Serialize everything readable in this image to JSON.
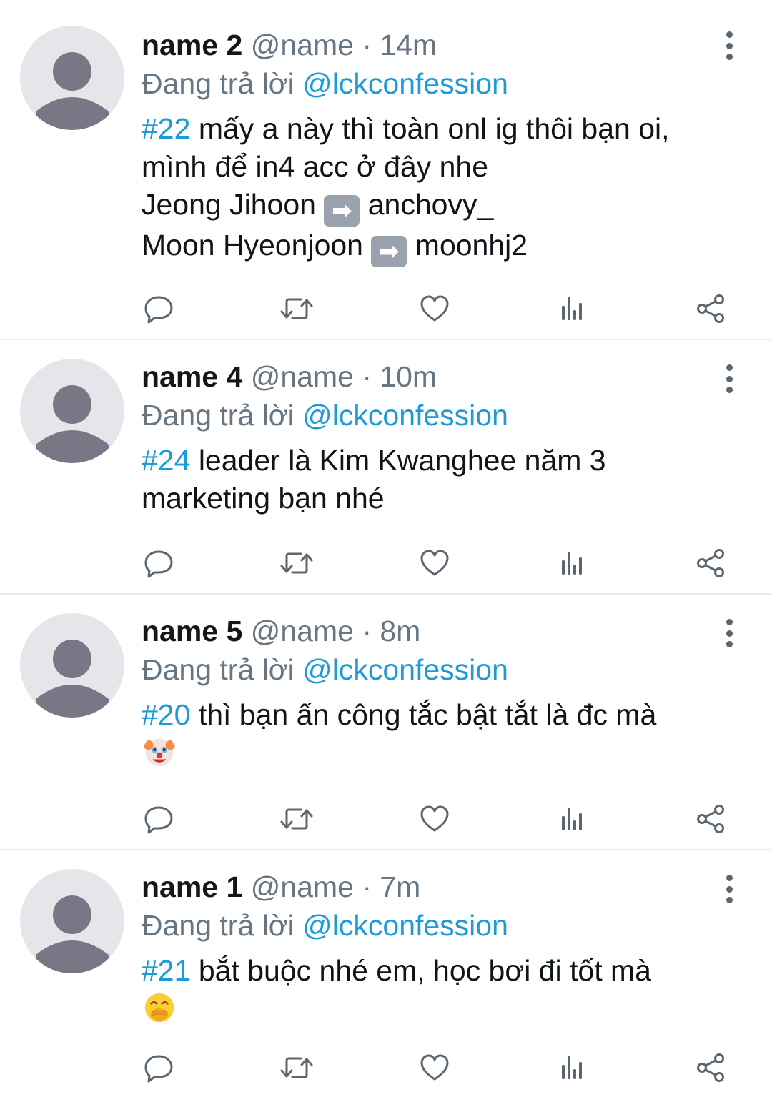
{
  "colors": {
    "accent": "#1d9bd8",
    "secondary_text": "#687684",
    "divider": "#e6ecf0",
    "avatar_bg": "#e6e6ea",
    "avatar_fg": "#777785"
  },
  "tweets": [
    {
      "name": "name 2",
      "handle": "@name",
      "separator": "·",
      "time": "14m",
      "reply_prefix": "Đang trả lời",
      "reply_to": "@lckconfession",
      "tag": "#22",
      "text_first": "mấy a này thì toàn onl ig thôi bạn oi,",
      "lines": [
        {
          "before": "mình để in4 acc ở đây nhe"
        },
        {
          "before": "Jeong Jihoon",
          "arrow": "➡",
          "after": "anchovy_"
        },
        {
          "before": "Moon Hyeonjoon",
          "arrow": "➡",
          "after": "moonhj2"
        }
      ]
    },
    {
      "name": "name 4",
      "handle": "@name",
      "separator": "·",
      "time": "10m",
      "reply_prefix": "Đang trả lời",
      "reply_to": "@lckconfession",
      "tag": "#24",
      "text_first": "leader là Kim Kwanghee năm 3",
      "lines": [
        {
          "before": "marketing bạn nhé"
        }
      ]
    },
    {
      "name": "name 5",
      "handle": "@name",
      "separator": "·",
      "time": "8m",
      "reply_prefix": "Đang trả lời",
      "reply_to": "@lckconfession",
      "tag": "#20",
      "text_first": "thì bạn ấn công tắc bật tắt là đc mà",
      "emoji": "clown-face"
    },
    {
      "name": "name 1",
      "handle": "@name",
      "separator": "·",
      "time": "7m",
      "reply_prefix": "Đang trả lời",
      "reply_to": "@lckconfession",
      "tag": "#21",
      "text_first": "bắt buộc nhé em, học bơi đi tốt mà",
      "emoji": "face-with-hand-over-mouth"
    }
  ],
  "action_icons": [
    "reply-icon",
    "retweet-icon",
    "like-icon",
    "analytics-icon",
    "share-icon"
  ]
}
